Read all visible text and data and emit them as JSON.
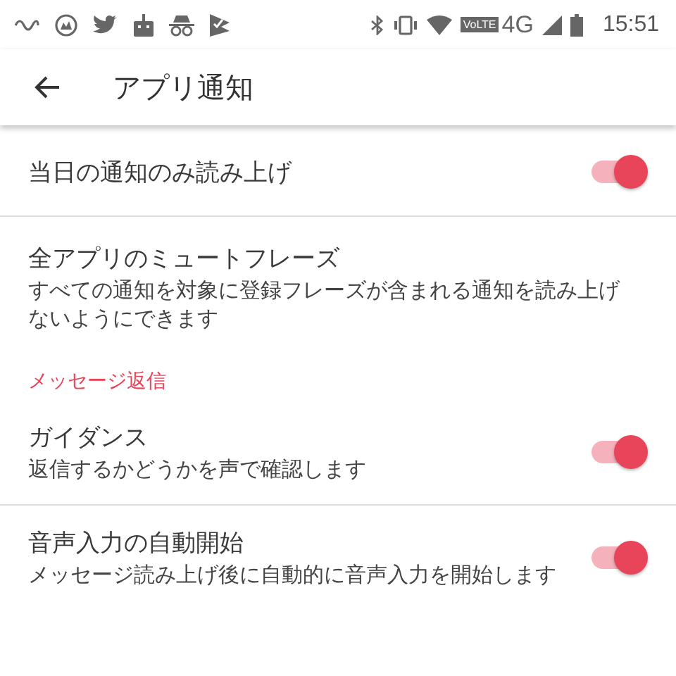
{
  "status_bar": {
    "volte": "VoLTE",
    "network": "4G",
    "time": "15:51"
  },
  "app_bar": {
    "title": "アプリ通知"
  },
  "items": [
    {
      "kind": "toggle",
      "title": "当日の通知のみ読み上げ",
      "on": true,
      "divider": true
    },
    {
      "kind": "text",
      "title": "全アプリのミュートフレーズ",
      "summary": "すべての通知を対象に登録フレーズが含まれる通知を読み上げないようにできます",
      "divider": false
    },
    {
      "kind": "header",
      "title": "メッセージ返信"
    },
    {
      "kind": "toggle",
      "title": "ガイダンス",
      "summary": "返信するかどうかを声で確認します",
      "on": true,
      "divider": true
    },
    {
      "kind": "toggle",
      "title": "音声入力の自動開始",
      "summary": "メッセージ読み上げ後に自動的に音声入力を開始します",
      "on": true,
      "divider": false
    }
  ]
}
